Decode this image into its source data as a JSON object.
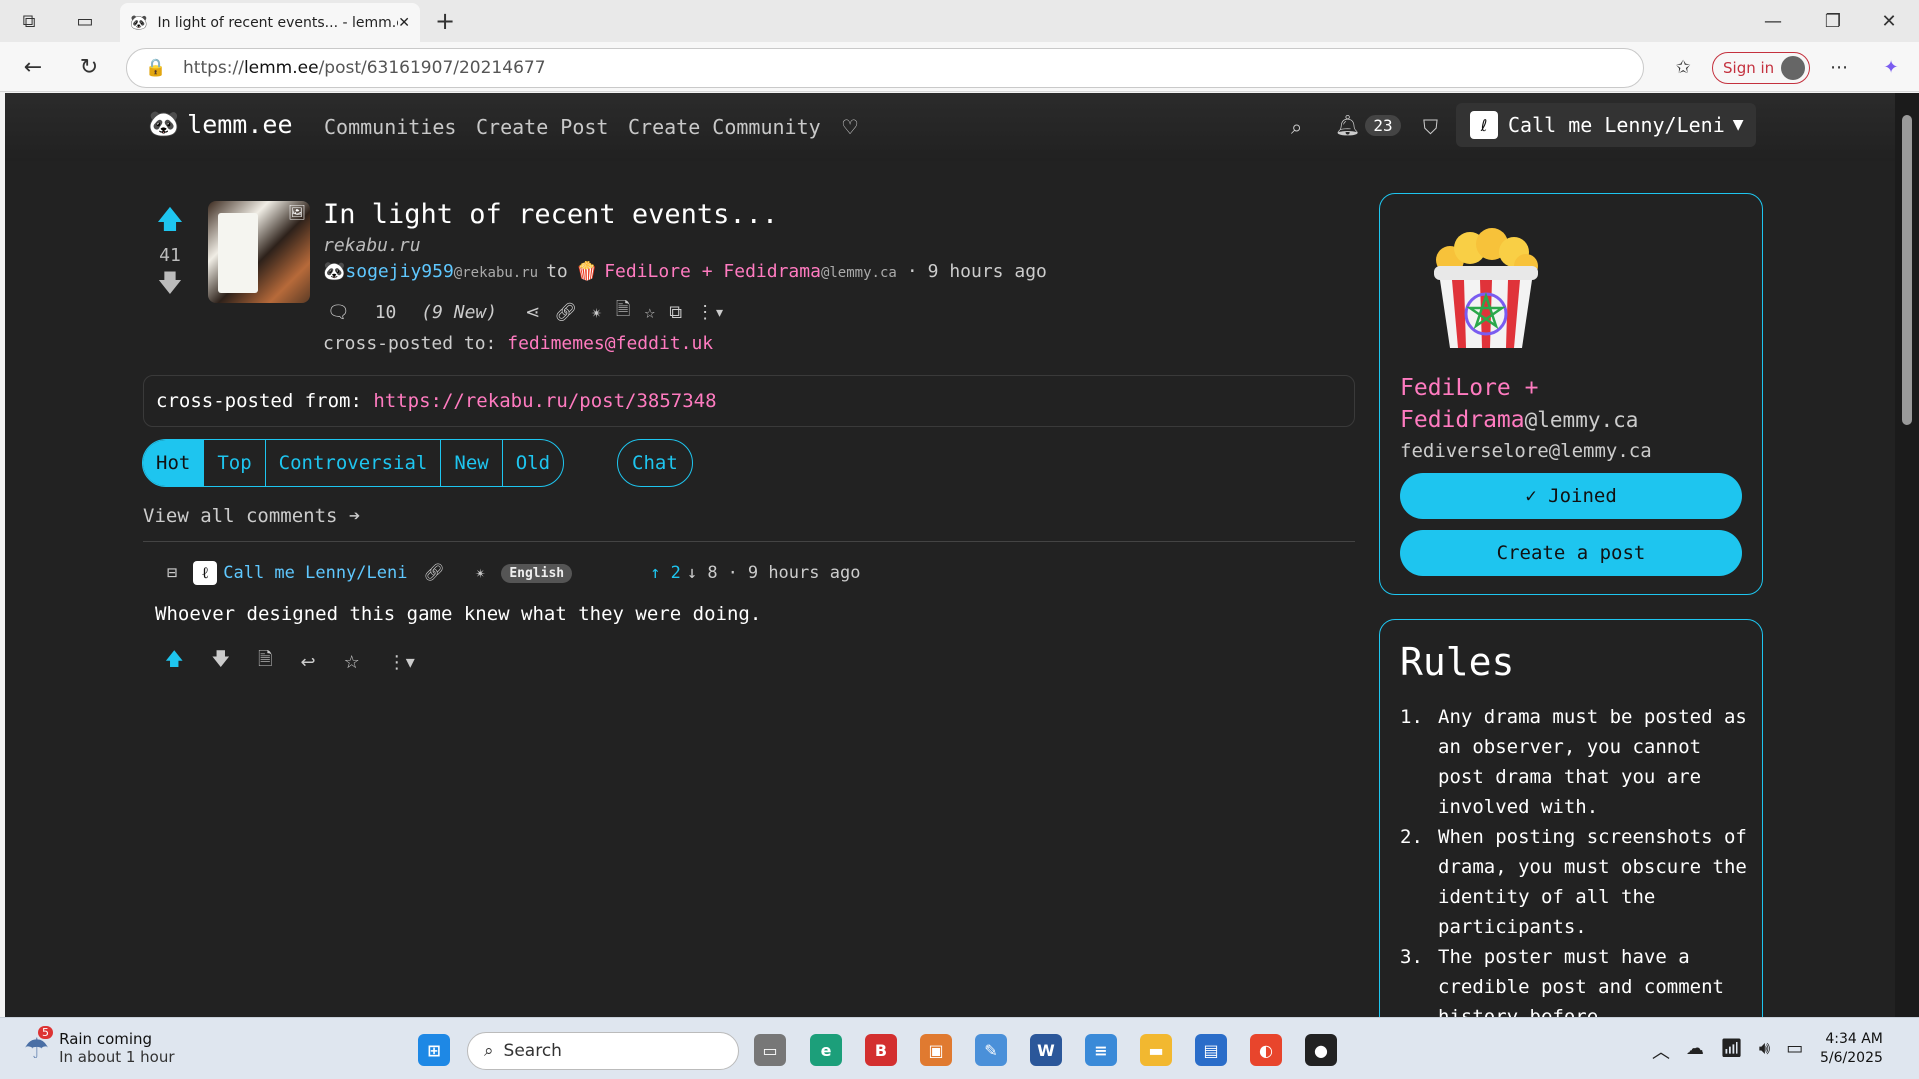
{
  "browser": {
    "tab_title": "In light of recent events... - lemm.ee",
    "url_prefix": "https://",
    "url_host": "lemm.ee",
    "url_path": "/post/63161907/20214677",
    "signin_label": "Sign in"
  },
  "navbar": {
    "brand": "lemm.ee",
    "links": [
      "Communities",
      "Create Post",
      "Create Community"
    ],
    "notification_count": "23",
    "username": "Call me Lenny/Leni"
  },
  "post": {
    "score": "41",
    "title": "In light of recent events...",
    "domain": "rekabu.ru",
    "author": "sogejiy959",
    "author_instance": "@rekabu.ru",
    "to_label": "to",
    "community": "FediLore + Fedidrama",
    "community_instance": "@lemmy.ca",
    "time": "9 hours ago",
    "comment_count": "10",
    "new_count": "(9 New)",
    "crossposted_to_label": "cross-posted to:",
    "crossposted_to": "fedimemes@feddit.uk",
    "crossposted_from_label": "cross-posted from:",
    "crossposted_from": "https://rekabu.ru/post/3857348"
  },
  "sort": {
    "options": [
      "Hot",
      "Top",
      "Controversial",
      "New",
      "Old"
    ],
    "active": "Hot",
    "chat_label": "Chat",
    "view_all": "View all comments ➔"
  },
  "comment": {
    "author": "Call me Lenny/Leni",
    "language": "English",
    "upvotes": "2",
    "downvotes": "8",
    "time": "9 hours ago",
    "body": "Whoever designed this game knew what they were doing."
  },
  "sidebar": {
    "community_name": "FediLore + Fedidrama",
    "community_instance": "@lemmy.ca",
    "handle": "fediverselore@lemmy.ca",
    "joined_label": "Joined",
    "create_post_label": "Create a post",
    "rules_title": "Rules",
    "rules": [
      "Any drama must be posted as an observer, you cannot post drama that you are involved with.",
      "When posting screenshots of drama, you must obscure the identity of all the participants.",
      "The poster must have a credible post and comment history before"
    ]
  },
  "taskbar": {
    "weather_title": "Rain coming",
    "weather_sub": "In about 1 hour",
    "weather_badge": "5",
    "search_label": "Search",
    "time": "4:34 AM",
    "date": "5/6/2025"
  },
  "colors": {
    "accent": "#1ec5ef",
    "link_pink": "#ff7bc0",
    "page_bg": "#222222"
  }
}
